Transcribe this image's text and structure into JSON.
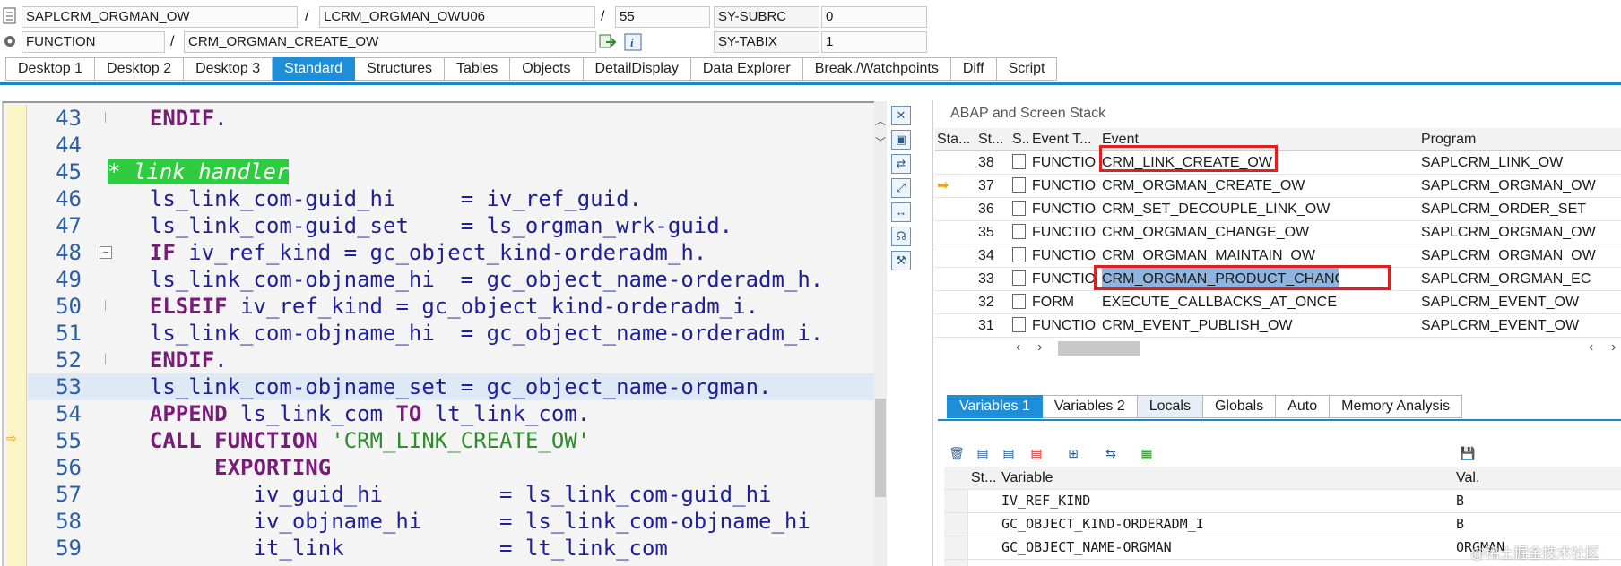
{
  "header": {
    "program": "SAPLCRM_ORGMAN_OW",
    "include": "LCRM_ORGMAN_OWU06",
    "line": "55",
    "sy_subrc_label": "SY-SUBRC",
    "sy_subrc_value": "0",
    "kind": "FUNCTION",
    "object": "CRM_ORGMAN_CREATE_OW",
    "sy_tabix_label": "SY-TABIX",
    "sy_tabix_value": "1",
    "sep": "/"
  },
  "tabs": [
    "Desktop 1",
    "Desktop 2",
    "Desktop 3",
    "Standard",
    "Structures",
    "Tables",
    "Objects",
    "DetailDisplay",
    "Data Explorer",
    "Break./Watchpoints",
    "Diff",
    "Script"
  ],
  "code": {
    "lines": [
      {
        "num": "43",
        "pre": "",
        "kw": "ENDIF",
        "rest": "."
      },
      {
        "num": "44"
      },
      {
        "num": "45",
        "comment": "* link handler"
      },
      {
        "num": "46",
        "text": "ls_link_com-guid_hi     = iv_ref_guid."
      },
      {
        "num": "47",
        "text": "ls_link_com-guid_set    = ls_orgman_wrk-guid."
      },
      {
        "num": "48",
        "kw": "IF",
        "rest": " iv_ref_kind = gc_object_kind-orderadm_h."
      },
      {
        "num": "49",
        "text": "  ls_link_com-objname_hi  = gc_object_name-orderadm_h."
      },
      {
        "num": "50",
        "kw": "ELSEIF",
        "rest": " iv_ref_kind = gc_object_kind-orderadm_i."
      },
      {
        "num": "51",
        "text": "  ls_link_com-objname_hi  = gc_object_name-orderadm_i."
      },
      {
        "num": "52",
        "kw": "ENDIF",
        "rest": "."
      },
      {
        "num": "53",
        "text": "ls_link_com-objname_set = gc_object_name-orgman."
      },
      {
        "num": "54",
        "kw": "APPEND",
        "mid": " ls_link_com ",
        "kw2": "TO",
        "rest": " lt_link_com."
      },
      {
        "num": "55",
        "kw": "CALL FUNCTION",
        "str": " 'CRM_LINK_CREATE_OW'"
      },
      {
        "num": "56",
        "kwIndent": "EXPORTING"
      },
      {
        "num": "57",
        "text": "          iv_guid_hi         = ls_link_com-guid_hi"
      },
      {
        "num": "58",
        "text": "          iv_objname_hi      = ls_link_com-objname_hi"
      },
      {
        "num": "59",
        "text": "          it_link            = lt_link_com"
      }
    ]
  },
  "stack": {
    "title": "ABAP and Screen Stack",
    "columns": [
      "Sta...",
      "St...",
      "S...",
      "Event T...",
      "Event",
      "Program"
    ],
    "rows": [
      {
        "st": "38",
        "type": "FUNCTIO...",
        "event": "CRM_LINK_CREATE_OW",
        "program": "SAPLCRM_LINK_OW"
      },
      {
        "st": "37",
        "type": "FUNCTIO...",
        "event": "CRM_ORGMAN_CREATE_OW",
        "program": "SAPLCRM_ORGMAN_OW"
      },
      {
        "st": "36",
        "type": "FUNCTIO...",
        "event": "CRM_SET_DECOUPLE_LINK_OW",
        "program": "SAPLCRM_ORDER_SET"
      },
      {
        "st": "35",
        "type": "FUNCTIO...",
        "event": "CRM_ORGMAN_CHANGE_OW",
        "program": "SAPLCRM_ORGMAN_OW"
      },
      {
        "st": "34",
        "type": "FUNCTIO...",
        "event": "CRM_ORGMAN_MAINTAIN_OW",
        "program": "SAPLCRM_ORGMAN_OW"
      },
      {
        "st": "33",
        "type": "FUNCTIO...",
        "event": "CRM_ORGMAN_PRODUCT_CHANGED_EC",
        "program": "SAPLCRM_ORGMAN_EC"
      },
      {
        "st": "32",
        "type": "FORM",
        "event": "EXECUTE_CALLBACKS_AT_ONCE",
        "program": "SAPLCRM_EVENT_OW"
      },
      {
        "st": "31",
        "type": "FUNCTIO...",
        "event": "CRM_EVENT_PUBLISH_OW",
        "program": "SAPLCRM_EVENT_OW"
      }
    ]
  },
  "var_tabs": [
    "Variables 1",
    "Variables 2",
    "Locals",
    "Globals",
    "Auto",
    "Memory Analysis"
  ],
  "variables": {
    "columns": [
      "St...",
      "Variable",
      "Val."
    ],
    "rows": [
      {
        "name": "IV_REF_KIND",
        "value": "B"
      },
      {
        "name": "GC_OBJECT_KIND-ORDERADM_I",
        "value": "B"
      },
      {
        "name": "GC_OBJECT_NAME-ORGMAN",
        "value": "ORGMAN"
      }
    ]
  },
  "watermark": "@稀土掘金技术社区",
  "colors": {
    "accent": "#1e8ed8",
    "highlight": "#e02020",
    "comment_bg": "#2ecc40"
  }
}
